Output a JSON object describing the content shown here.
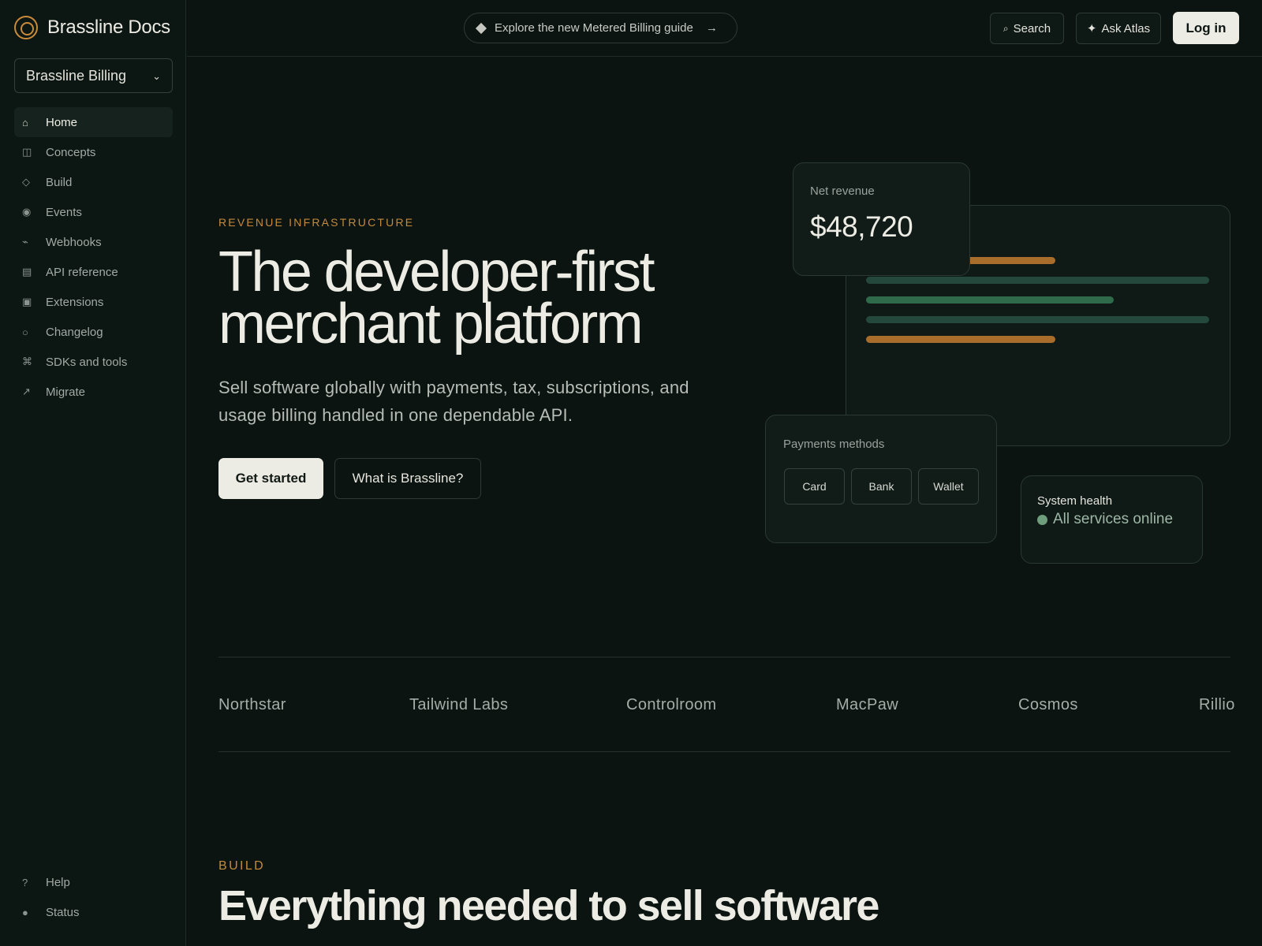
{
  "brand": {
    "name": "Brassline Docs",
    "accent": "#c98b3a"
  },
  "product_select": {
    "value": "Brassline Billing",
    "chevron": "⌄"
  },
  "sidebar": {
    "items": [
      {
        "label": "Home",
        "icon": "home-icon",
        "glyph": "⌂",
        "active": true
      },
      {
        "label": "Concepts",
        "icon": "book-icon",
        "glyph": "◫"
      },
      {
        "label": "Build",
        "icon": "diamond-icon",
        "glyph": "◇"
      },
      {
        "label": "Events",
        "icon": "radio-icon",
        "glyph": "◉"
      },
      {
        "label": "Webhooks",
        "icon": "webhook-icon",
        "glyph": "⌁"
      },
      {
        "label": "API reference",
        "icon": "code-doc-icon",
        "glyph": "▤"
      },
      {
        "label": "Extensions",
        "icon": "puzzle-icon",
        "glyph": "▣"
      },
      {
        "label": "Changelog",
        "icon": "circle-icon",
        "glyph": "○"
      },
      {
        "label": "SDKs and tools",
        "icon": "command-icon",
        "glyph": "⌘"
      },
      {
        "label": "Migrate",
        "icon": "arrow-up-right-icon",
        "glyph": "↗"
      }
    ],
    "bottom": [
      {
        "label": "Help",
        "icon": "help-icon",
        "glyph": "?"
      },
      {
        "label": "Status",
        "icon": "status-dot-icon",
        "glyph": "●"
      }
    ]
  },
  "topbar": {
    "announcement": "Explore the new Metered Billing guide",
    "announcement_arrow": "→",
    "search_label": "Search",
    "search_glyph": "⌕",
    "atlas_label": "Ask Atlas",
    "atlas_glyph": "✦",
    "login_label": "Log in"
  },
  "hero": {
    "eyebrow": "REVENUE INFRASTRUCTURE",
    "title": "The developer-first merchant platform",
    "subtitle": "Sell software globally with payments, tax, subscriptions, and usage billing handled in one dependable API.",
    "primary_cta": "Get started",
    "secondary_cta": "What is Brassline?"
  },
  "visual": {
    "revenue_label": "Net revenue",
    "revenue_value": "$48,720",
    "payments_label": "Payments methods",
    "payment_methods": [
      "Card",
      "Bank",
      "Wallet"
    ],
    "health_label": "System health",
    "health_status": "All services online",
    "colors": {
      "gold": "#a86c2b",
      "teal": "#25483c",
      "green": "#2f6a4b",
      "status": "#6e9e7c"
    }
  },
  "logos": [
    "Northstar",
    "Tailwind Labs",
    "Controlroom",
    "MacPaw",
    "Cosmos",
    "Rillio"
  ],
  "build": {
    "eyebrow": "BUILD",
    "title": "Everything needed to sell software"
  }
}
